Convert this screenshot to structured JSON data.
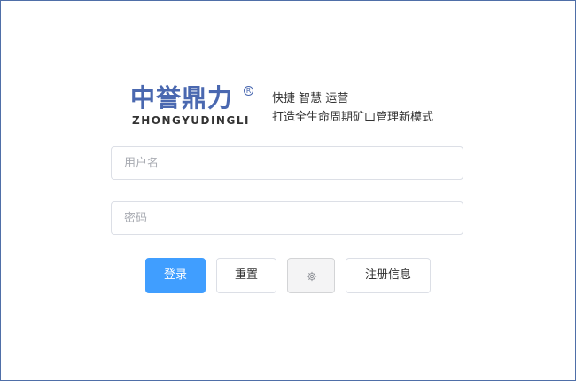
{
  "brand": {
    "logo_cn": "中誉鼎力",
    "logo_en": "ZHONGYUDINGLI",
    "registered": "R",
    "colors": {
      "logo": "#4a68b0"
    }
  },
  "tagline": {
    "line1": "快捷 智慧 运营",
    "line2": "打造全生命周期矿山管理新模式"
  },
  "form": {
    "username_placeholder": "用户名",
    "username_value": "",
    "password_placeholder": "密码",
    "password_value": ""
  },
  "buttons": {
    "login": "登录",
    "reset": "重置",
    "settings_icon": "gear-icon",
    "register": "注册信息"
  },
  "colors": {
    "primary": "#409eff",
    "border": "#dcdfe6"
  }
}
